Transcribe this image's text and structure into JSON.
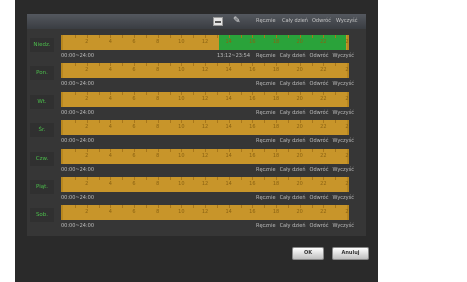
{
  "toolbar": {
    "links": [
      "Ręcznie",
      "Cały dzień",
      "Odwróć",
      "Wyczyść"
    ]
  },
  "hours": [
    "2",
    "4",
    "6",
    "8",
    "10",
    "12",
    "14",
    "16",
    "18",
    "20",
    "22",
    "2"
  ],
  "rows": [
    {
      "day": "Niedz.",
      "range": "00:00~24:00",
      "selection": "13:12~23:54",
      "green_from_hour": 13.2,
      "green_to_hour": 23.9,
      "active": true
    },
    {
      "day": "Pon.",
      "range": "00:00~24:00",
      "selection": ""
    },
    {
      "day": "Wt.",
      "range": "00:00~24:00",
      "selection": ""
    },
    {
      "day": "Śr.",
      "range": "00:00~24:00",
      "selection": ""
    },
    {
      "day": "Czw.",
      "range": "00:00~24:00",
      "selection": ""
    },
    {
      "day": "Piąt.",
      "range": "00:00~24:00",
      "selection": ""
    },
    {
      "day": "Sob.",
      "range": "00:00~24:00",
      "selection": ""
    }
  ],
  "row_links": [
    "Ręcznie",
    "Cały dzień",
    "Odwróć",
    "Wyczyść"
  ],
  "buttons": {
    "ok": "OK",
    "cancel": "Anuluj"
  },
  "colors": {
    "schedule": "#c8952a",
    "selected": "#2aa33a",
    "day_label": "#4cc04c"
  }
}
